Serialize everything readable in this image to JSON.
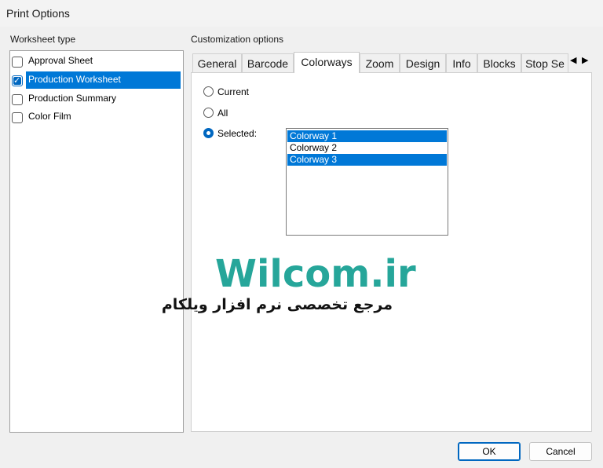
{
  "window": {
    "title": "Print Options"
  },
  "worksheet": {
    "label": "Worksheet type",
    "items": [
      {
        "label": "Approval Sheet",
        "checked": false,
        "selected": false
      },
      {
        "label": "Production Worksheet",
        "checked": true,
        "selected": true
      },
      {
        "label": "Production Summary",
        "checked": false,
        "selected": false
      },
      {
        "label": "Color Film",
        "checked": false,
        "selected": false
      }
    ]
  },
  "customization": {
    "label": "Customization options",
    "tabs": [
      "General",
      "Barcode",
      "Colorways",
      "Zoom",
      "Design",
      "Info",
      "Blocks",
      "Stop Se"
    ],
    "active_tab": "Colorways"
  },
  "colorways": {
    "options": [
      {
        "label": "Current",
        "selected": false
      },
      {
        "label": "All",
        "selected": false
      },
      {
        "label": "Selected:",
        "selected": true
      }
    ],
    "list": [
      {
        "label": "Colorway 1",
        "selected": true
      },
      {
        "label": "Colorway 2",
        "selected": false
      },
      {
        "label": "Colorway 3",
        "selected": true
      }
    ]
  },
  "watermark": {
    "title": "Wilcom.ir",
    "subtitle": "مرجع تخصصی نرم افزار ویلکام",
    "color": "#26a69a"
  },
  "buttons": {
    "ok": "OK",
    "cancel": "Cancel"
  },
  "icons": {
    "scroll_left": "triangle-left-icon",
    "scroll_right": "triangle-right-icon"
  },
  "colors": {
    "selection": "#0078d7"
  }
}
